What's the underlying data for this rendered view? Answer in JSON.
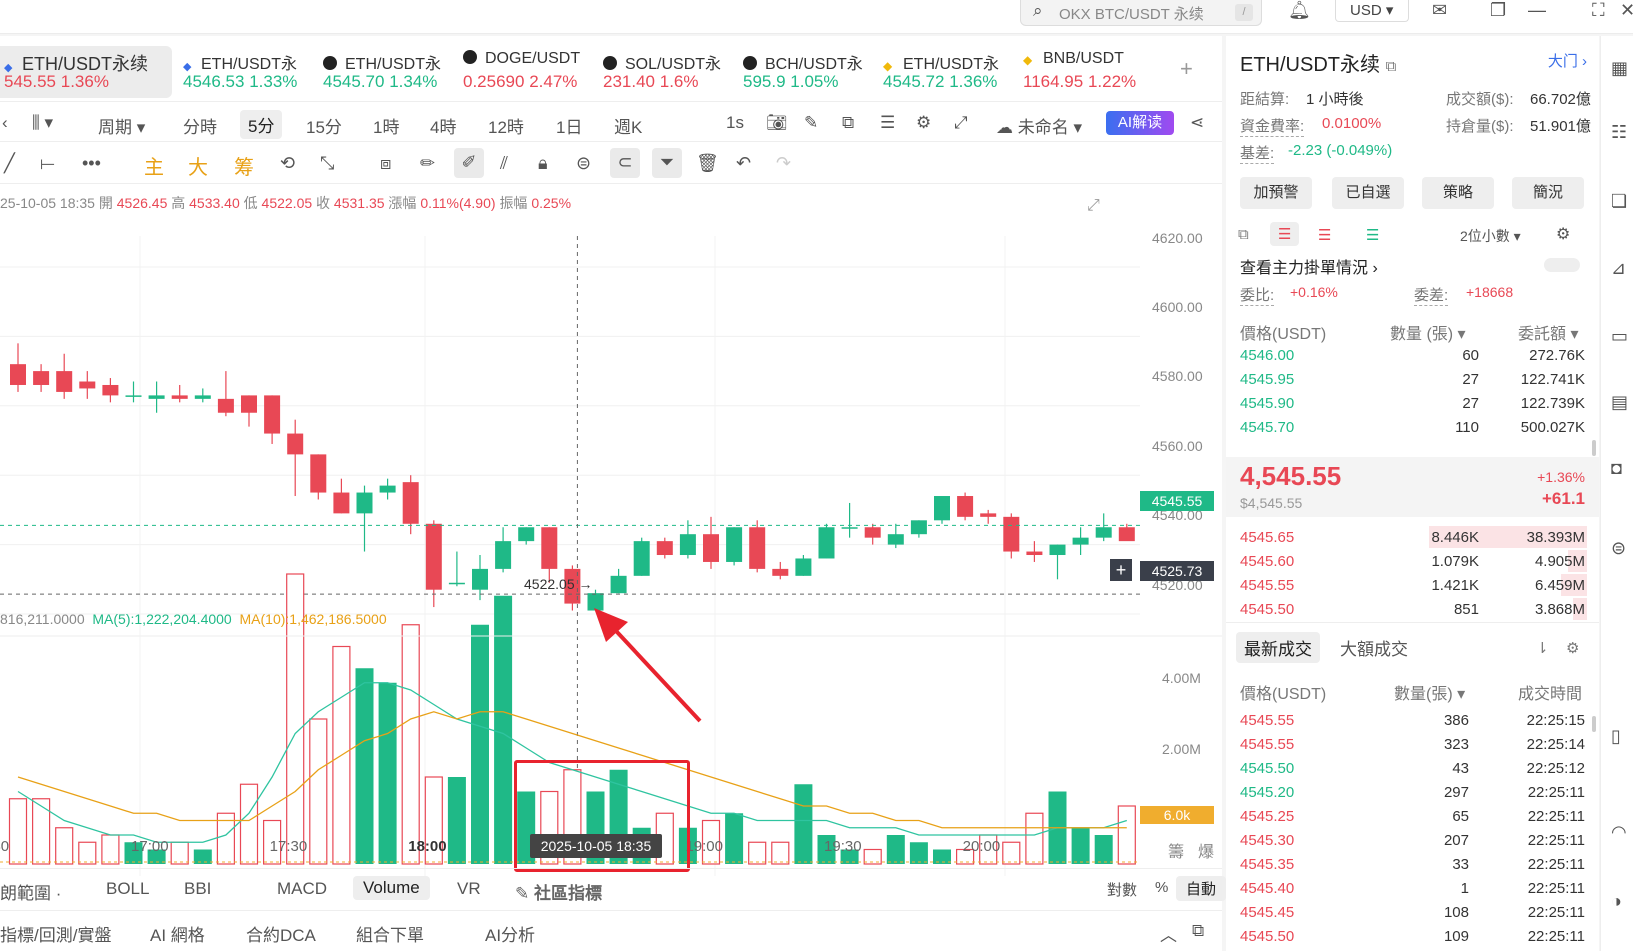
{
  "topbar": {
    "search_placeholder": "OKX BTC/USDT 永续",
    "search_shortcut": "/",
    "currency": "USD"
  },
  "tickers": [
    {
      "name": "ETH/USDT永续",
      "price": "545.55",
      "change": "1.36%",
      "dir": "down"
    },
    {
      "name": "ETH/USDT永",
      "price": "4546.53",
      "change": "1.33%",
      "dir": "up"
    },
    {
      "name": "ETH/USDT永",
      "price": "4545.70",
      "change": "1.34%",
      "dir": "up"
    },
    {
      "name": "DOGE/USDT",
      "price": "0.25690",
      "change": "2.47%",
      "dir": "down"
    },
    {
      "name": "SOL/USDT永",
      "price": "231.40",
      "change": "1.6%",
      "dir": "down"
    },
    {
      "name": "BCH/USDT永",
      "price": "595.9",
      "change": "1.05%",
      "dir": "up"
    },
    {
      "name": "ETH/USDT永",
      "price": "4545.72",
      "change": "1.36%",
      "dir": "up"
    },
    {
      "name": "BNB/USDT",
      "price": "1164.95",
      "change": "1.22%",
      "dir": "down"
    }
  ],
  "periods": {
    "cycle": "周期",
    "items": [
      "分時",
      "5分",
      "15分",
      "1時",
      "4時",
      "12時",
      "1日",
      "週K",
      "1s"
    ],
    "active": "5分",
    "layout_name": "未命名",
    "ai_label": "AI解读"
  },
  "toolbar": {
    "zhu": "主",
    "da": "大",
    "chou": "筹"
  },
  "ohlc": {
    "time": "25-10-05 18:35",
    "open_label": "開",
    "open": "4526.45",
    "high_label": "高",
    "high": "4533.40",
    "low_label": "低",
    "low": "4522.05",
    "close_label": "收",
    "close": "4531.35",
    "chg_label": "漲幅",
    "chg": "0.11%(4.90)",
    "amp_label": "振幅",
    "amp": "0.25%"
  },
  "chart_data": {
    "type": "candlestick",
    "price_axis": [
      "4620.00",
      "4600.00",
      "4580.00",
      "4560.00",
      "4540.00",
      "4520.00"
    ],
    "ylim": [
      4514,
      4628
    ],
    "current_price": "4545.55",
    "crosshair_price": "4525.73",
    "low_marker": "4522.05",
    "candles": [
      [
        4592,
        4598,
        4584,
        4586
      ],
      [
        4590,
        4592,
        4584,
        4586
      ],
      [
        4590,
        4595,
        4582,
        4584
      ],
      [
        4587,
        4590,
        4582,
        4585
      ],
      [
        4586,
        4588,
        4581,
        4583
      ],
      [
        4583,
        4587,
        4581,
        4583
      ],
      [
        4582,
        4587,
        4578,
        4583
      ],
      [
        4583,
        4586,
        4581,
        4582
      ],
      [
        4582,
        4585,
        4581,
        4583
      ],
      [
        4582,
        4590,
        4577,
        4578
      ],
      [
        4583,
        4583,
        4574,
        4578
      ],
      [
        4583,
        4583,
        4569,
        4572
      ],
      [
        4572,
        4576,
        4554,
        4566
      ],
      [
        4566,
        4566,
        4553,
        4555
      ],
      [
        4555,
        4559,
        4549,
        4549
      ],
      [
        4549,
        4557,
        4538,
        4555
      ],
      [
        4555,
        4559,
        4553,
        4557
      ],
      [
        4558,
        4560,
        4543,
        4546
      ],
      [
        4546,
        4547,
        4522,
        4527
      ],
      [
        4529,
        4538,
        4528,
        4529
      ],
      [
        4527,
        4537,
        4524,
        4533
      ],
      [
        4533,
        4545,
        4532,
        4541
      ],
      [
        4541,
        4545,
        4540,
        4545
      ],
      [
        4545,
        4545,
        4529,
        4533
      ],
      [
        4533,
        4534,
        4521,
        4523
      ],
      [
        4521,
        4527,
        4521,
        4526
      ],
      [
        4526,
        4533,
        4526,
        4531
      ],
      [
        4531,
        4542,
        4531,
        4541
      ],
      [
        4541,
        4542,
        4536,
        4537
      ],
      [
        4537,
        4547,
        4536,
        4543
      ],
      [
        4543,
        4548,
        4533,
        4535
      ],
      [
        4535,
        4545,
        4534,
        4545
      ],
      [
        4545,
        4547,
        4532,
        4533
      ],
      [
        4533,
        4535,
        4530,
        4531
      ],
      [
        4531,
        4537,
        4531,
        4536
      ],
      [
        4536,
        4546,
        4536,
        4545
      ],
      [
        4545,
        4552,
        4542,
        4545
      ],
      [
        4545,
        4546,
        4540,
        4542
      ],
      [
        4540,
        4546,
        4539,
        4543
      ],
      [
        4543,
        4547,
        4542,
        4547
      ],
      [
        4547,
        4553,
        4546,
        4554
      ],
      [
        4554,
        4555,
        4547,
        4548
      ],
      [
        4549,
        4550,
        4546,
        4548
      ],
      [
        4548,
        4549,
        4536,
        4538
      ],
      [
        4538,
        4541,
        4535,
        4537
      ],
      [
        4537,
        4540,
        4530,
        4540
      ],
      [
        4540,
        4545,
        4537,
        4542
      ],
      [
        4542,
        4549,
        4541,
        4545
      ],
      [
        4545,
        4546,
        4543,
        4541
      ]
    ],
    "ma_legend": {
      "vol": "816,211.0000",
      "ma5": "MA(5):1,222,204.4000",
      "ma10": "MA(10):1,462,186.5000"
    },
    "volume_axis": [
      "4.00M",
      "2.00M"
    ],
    "volume_current": "6.0k",
    "volumes": [
      0.9,
      0.9,
      0.5,
      0.3,
      0.4,
      0.3,
      0.2,
      0.3,
      0.2,
      0.7,
      1.1,
      0.6,
      4.0,
      2.0,
      3.0,
      2.7,
      2.5,
      3.3,
      1.2,
      1.2,
      3.3,
      3.7,
      1.0,
      1.0,
      1.3,
      1.0,
      1.3,
      0.5,
      0.7,
      0.5,
      0.6,
      0.7,
      0.3,
      0.3,
      1.1,
      0.4,
      0.2,
      0.2,
      0.4,
      0.3,
      0.2,
      0.2,
      0.4,
      0.3,
      0.7,
      1.0,
      0.5,
      0.4,
      0.8
    ],
    "ma5_vol": [
      1.0,
      0.8,
      0.6,
      0.5,
      0.4,
      0.4,
      0.3,
      0.3,
      0.3,
      0.4,
      0.7,
      1.2,
      1.8,
      2.1,
      2.3,
      2.5,
      2.5,
      2.4,
      2.2,
      2.0,
      1.9,
      1.8,
      1.6,
      1.4,
      1.3,
      1.2,
      1.1,
      1.0,
      0.9,
      0.8,
      0.7,
      0.7,
      0.6,
      0.6,
      0.6,
      0.6,
      0.5,
      0.5,
      0.5,
      0.4,
      0.4,
      0.4,
      0.4,
      0.4,
      0.4,
      0.5,
      0.5,
      0.5,
      0.6
    ],
    "ma10_vol": [
      1.2,
      1.1,
      1.0,
      0.9,
      0.8,
      0.7,
      0.7,
      0.6,
      0.6,
      0.6,
      0.6,
      0.8,
      1.0,
      1.3,
      1.5,
      1.7,
      1.8,
      2.0,
      2.1,
      2.0,
      2.1,
      2.1,
      2.0,
      1.9,
      1.8,
      1.7,
      1.6,
      1.5,
      1.4,
      1.3,
      1.2,
      1.1,
      1.0,
      0.9,
      0.8,
      0.8,
      0.7,
      0.7,
      0.6,
      0.6,
      0.5,
      0.5,
      0.5,
      0.5,
      0.5,
      0.5,
      0.5,
      0.5,
      0.5
    ],
    "time_labels": [
      {
        "t": "30",
        "i": -0.5
      },
      {
        "t": "17:00",
        "i": 5.5
      },
      {
        "t": "17:30",
        "i": 11.5
      },
      {
        "t": "18:00",
        "i": 17.5
      },
      {
        "t": "19:00",
        "i": 29.5
      },
      {
        "t": "19:30",
        "i": 35.5
      },
      {
        "t": "20:00",
        "i": 41.5
      }
    ],
    "crosshair_index": 24,
    "crosshair_time": "2025-10-05 18:35",
    "vol_units": {
      "a": "籌",
      "b": "爆"
    }
  },
  "indicators": {
    "range_label": "朗範圍",
    "items": [
      "BOLL",
      "BBI",
      "MACD",
      "Volume",
      "VR"
    ],
    "active": "Volume",
    "community": "社區指標",
    "scale_log": "對數",
    "scale_pct": "%",
    "scale_auto": "自動"
  },
  "bottom": [
    "指標/回測/實盤",
    "AI 網格",
    "合約DCA",
    "組合下單",
    "AI分析"
  ],
  "right": {
    "title": "ETH/USDT永续",
    "hall": "大门",
    "settle_label": "距結算:",
    "settle": "1 小時後",
    "volume_label": "成交額($):",
    "volume": "66.702億",
    "funding_label": "資金費率:",
    "funding": "0.0100%",
    "oi_label": "持倉量($):",
    "oi": "51.901億",
    "basis_label": "基差:",
    "basis": "-2.23 (-0.049%)",
    "buttons": [
      "加預警",
      "已自選",
      "策略",
      "簡況"
    ],
    "decimals": "2位小數",
    "main_orders": "查看主力掛單情況",
    "ratio_label": "委比:",
    "ratio": "+0.16%",
    "diff_label": "委差:",
    "diff": "+18668",
    "ob_headers": [
      "價格(USDT)",
      "數量 (張)",
      "委託額"
    ],
    "asks": [
      {
        "p": "4546.00",
        "q": "60",
        "t": "272.76K"
      },
      {
        "p": "4545.95",
        "q": "27",
        "t": "122.741K"
      },
      {
        "p": "4545.90",
        "q": "27",
        "t": "122.739K"
      },
      {
        "p": "4545.70",
        "q": "110",
        "t": "500.027K"
      }
    ],
    "last_price": "4,545.55",
    "last_usd": "$4,545.55",
    "last_pct": "+1.36%",
    "last_chg": "+61.1",
    "bids": [
      {
        "p": "4545.65",
        "q": "8.446K",
        "t": "38.393M",
        "depth": 0.66
      },
      {
        "p": "4545.60",
        "q": "1.079K",
        "t": "4.905M",
        "depth": 0.08
      },
      {
        "p": "4545.55",
        "q": "1.421K",
        "t": "6.459M",
        "depth": 0.11
      },
      {
        "p": "4545.50",
        "q": "851",
        "t": "3.868M",
        "depth": 0.06
      }
    ],
    "trade_tabs": [
      "最新成交",
      "大額成交"
    ],
    "trade_headers": [
      "價格(USDT)",
      "數量(張)",
      "成交時間"
    ],
    "trades": [
      {
        "p": "4545.55",
        "q": "386",
        "t": "22:25:15",
        "c": "red"
      },
      {
        "p": "4545.55",
        "q": "323",
        "t": "22:25:14",
        "c": "red"
      },
      {
        "p": "4545.50",
        "q": "43",
        "t": "22:25:12",
        "c": "green"
      },
      {
        "p": "4545.20",
        "q": "297",
        "t": "22:25:11",
        "c": "green"
      },
      {
        "p": "4545.25",
        "q": "65",
        "t": "22:25:11",
        "c": "red"
      },
      {
        "p": "4545.30",
        "q": "207",
        "t": "22:25:11",
        "c": "red"
      },
      {
        "p": "4545.35",
        "q": "33",
        "t": "22:25:11",
        "c": "red"
      },
      {
        "p": "4545.40",
        "q": "1",
        "t": "22:25:11",
        "c": "red"
      },
      {
        "p": "4545.45",
        "q": "108",
        "t": "22:25:11",
        "c": "red"
      },
      {
        "p": "4545.50",
        "q": "109",
        "t": "22:25:11",
        "c": "red"
      }
    ]
  },
  "colors": {
    "up": "#1fb987",
    "down": "#e84855",
    "ma5": "#2fc4a0",
    "ma10": "#e8a117",
    "annotation": "#e8232e"
  }
}
